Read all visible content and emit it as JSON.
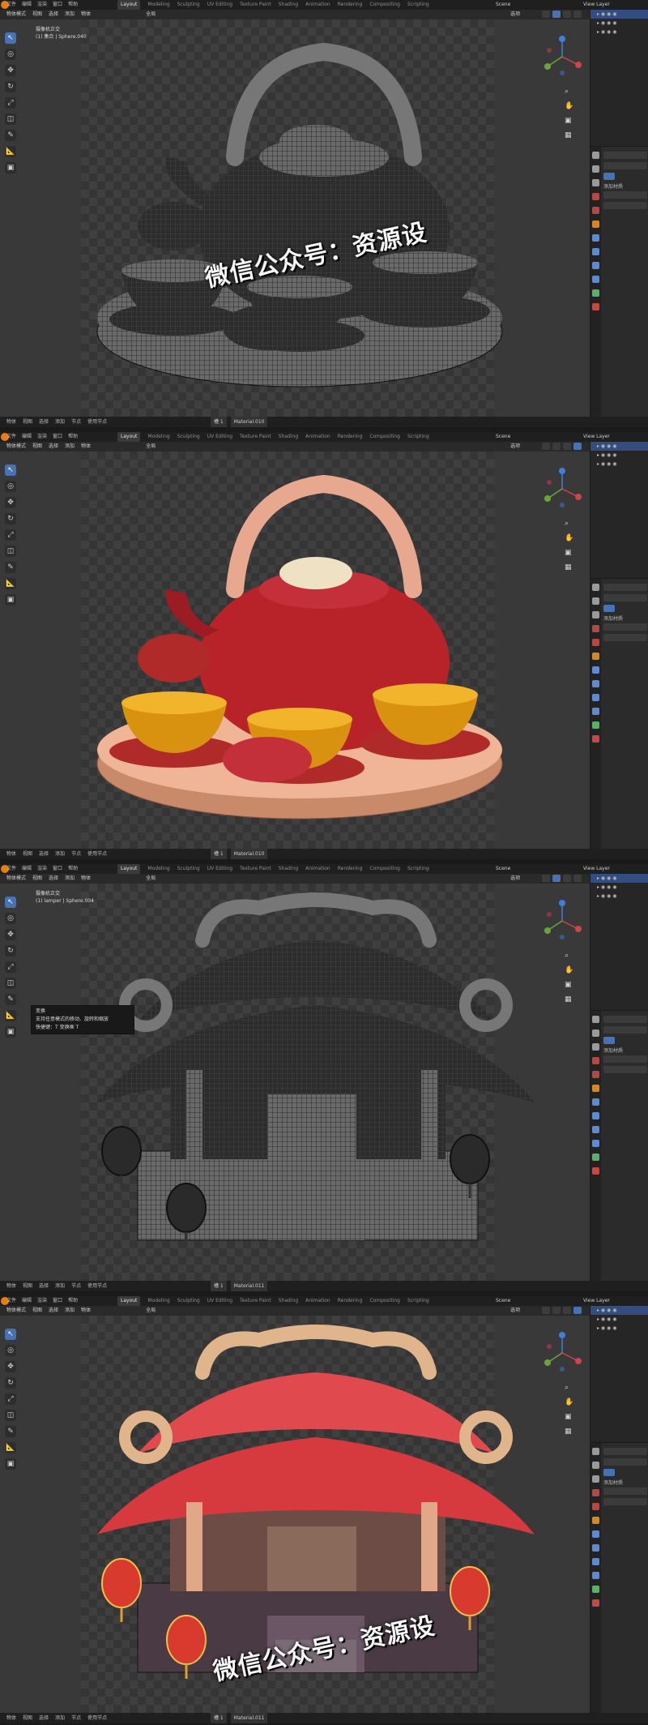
{
  "top_menu": [
    "文件",
    "编辑",
    "渲染",
    "窗口",
    "帮助"
  ],
  "workspaces": [
    "Layout",
    "Modeling",
    "Sculpting",
    "UV Editing",
    "Texture Paint",
    "Shading",
    "Animation",
    "Rendering",
    "Compositing",
    "Scripting"
  ],
  "active_workspace": "Layout",
  "scene_name": "Scene",
  "view_layer": "View Layer",
  "header_menu": [
    "物体模式",
    "视图",
    "选择",
    "添加",
    "物体"
  ],
  "transform_orientation": "全局",
  "options_label": "选项",
  "tools": [
    "select",
    "cursor",
    "move",
    "rotate",
    "scale",
    "transform",
    "annotate",
    "measure",
    "add-cube"
  ],
  "status_items": [
    "物体",
    "视图",
    "选择",
    "添加",
    "节点",
    "使用节点"
  ],
  "slot_label": "槽 1",
  "props_label": "添加材质",
  "watermark": "微信公众号：资源设",
  "panels": [
    {
      "name": "teapot-wireframe",
      "camera_label": "摄像机正交",
      "object_label": "(1) 集合 | Sphere.040",
      "material": "Material.010",
      "mode": "wireframe"
    },
    {
      "name": "teapot-render",
      "camera_label": "",
      "object_label": "",
      "material": "Material.010",
      "mode": "render"
    },
    {
      "name": "pavilion-wireframe",
      "camera_label": "摄像机正交",
      "object_label": "(1) lamper | Sphere.004",
      "material": "Material.011",
      "mode": "wireframe",
      "tooltip": [
        "变换",
        "支持任意模式的移动、旋转和缩放",
        "快捷键：T 变换框 T"
      ]
    },
    {
      "name": "pavilion-render",
      "camera_label": "",
      "object_label": "",
      "material": "Material.011",
      "mode": "render"
    }
  ],
  "colors": {
    "accent": "#4772b3",
    "blender_orange": "#e87d0d",
    "axis_x": "#d0424e",
    "axis_y": "#6ba53a",
    "axis_z": "#3f7fd9",
    "teapot_red": "#b8232a",
    "tea_gold": "#d8920f",
    "roof_red": "#d63a3f",
    "wood_tan": "#e0b58c"
  }
}
